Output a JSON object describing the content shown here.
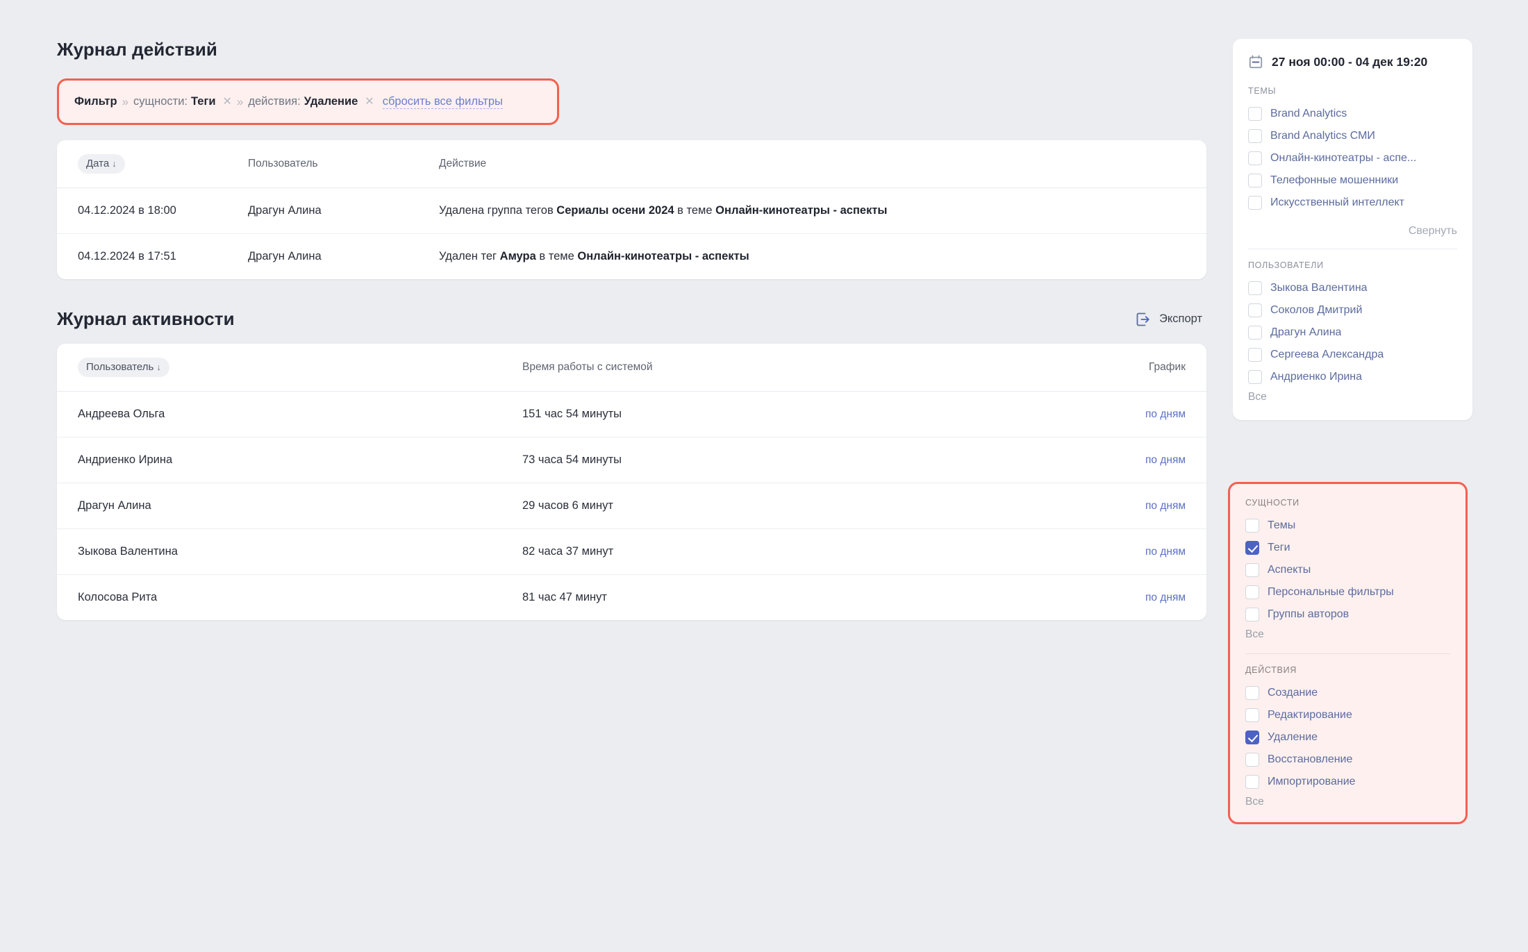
{
  "colors": {
    "page_bg": "#ECEDF0",
    "accent_red": "#F4604F",
    "highlight_bg": "#FDF0EE",
    "link_blue": "#5B6FC4",
    "checkbox_checked": "#4C63C4"
  },
  "action_log": {
    "title": "Журнал действий",
    "filter": {
      "label": "Фильтр",
      "sep": "»",
      "chips": [
        {
          "key": "сущности:",
          "value": "Теги",
          "remove": "✕"
        },
        {
          "key": "действия:",
          "value": "Удаление",
          "remove": "✕"
        }
      ],
      "reset_label": "сбросить все фильтры"
    },
    "columns": {
      "date": "Дата",
      "sort_arrow": "↓",
      "user": "Пользователь",
      "action": "Действие"
    },
    "rows": [
      {
        "date": "04.12.2024 в 18:00",
        "user": "Драгун Алина",
        "action_pre": "Удалена группа тегов ",
        "action_obj": "Сериалы осени 2024",
        "action_mid": " в теме ",
        "action_topic": "Онлайн-кинотеатры - аспекты"
      },
      {
        "date": "04.12.2024 в 17:51",
        "user": "Драгун Алина",
        "action_pre": "Удален тег ",
        "action_obj": "Амура",
        "action_mid": " в теме ",
        "action_topic": "Онлайн-кинотеатры - аспекты"
      }
    ]
  },
  "activity_log": {
    "title": "Журнал активности",
    "export_label": "Экспорт",
    "columns": {
      "user": "Пользователь",
      "sort_arrow": "↓",
      "time": "Время работы с системой",
      "chart": "График"
    },
    "rows": [
      {
        "user": "Андреева Ольга",
        "time": "151 час 54 минуты",
        "chart_link": "по дням"
      },
      {
        "user": "Андриенко Ирина",
        "time": "73 часа 54 минуты",
        "chart_link": "по дням"
      },
      {
        "user": "Драгун Алина",
        "time": "29 часов 6 минут",
        "chart_link": "по дням"
      },
      {
        "user": "Зыкова Валентина",
        "time": "82 часа 37 минут",
        "chart_link": "по дням"
      },
      {
        "user": "Колосова Рита",
        "time": "81 час 47 минут",
        "chart_link": "по дням"
      }
    ]
  },
  "sidebar": {
    "date_range": "27 ноя 00:00 - 04 дек 19:20",
    "themes": {
      "title": "Темы",
      "items": [
        {
          "label": "Brand Analytics",
          "checked": false
        },
        {
          "label": "Brand Analytics СМИ",
          "checked": false
        },
        {
          "label": "Онлайн-кинотеатры - аспе...",
          "checked": false
        },
        {
          "label": "Телефонные мошенники",
          "checked": false
        },
        {
          "label": "Искусственный интеллект",
          "checked": false
        }
      ],
      "collapse_label": "Свернуть"
    },
    "users": {
      "title": "Пользователи",
      "items": [
        {
          "label": "Зыкова Валентина",
          "checked": false
        },
        {
          "label": "Соколов Дмитрий",
          "checked": false
        },
        {
          "label": "Драгун Алина",
          "checked": false
        },
        {
          "label": "Сергеева Александра",
          "checked": false
        },
        {
          "label": "Андриенко Ирина",
          "checked": false
        }
      ],
      "all_label": "Все"
    },
    "entities": {
      "title": "Сущности",
      "items": [
        {
          "label": "Темы",
          "checked": false
        },
        {
          "label": "Теги",
          "checked": true
        },
        {
          "label": "Аспекты",
          "checked": false
        },
        {
          "label": "Персональные фильтры",
          "checked": false
        },
        {
          "label": "Группы авторов",
          "checked": false
        }
      ],
      "all_label": "Все"
    },
    "actions": {
      "title": "Действия",
      "items": [
        {
          "label": "Создание",
          "checked": false
        },
        {
          "label": "Редактирование",
          "checked": false
        },
        {
          "label": "Удаление",
          "checked": true
        },
        {
          "label": "Восстановление",
          "checked": false
        },
        {
          "label": "Импортирование",
          "checked": false
        }
      ],
      "all_label": "Все"
    }
  }
}
